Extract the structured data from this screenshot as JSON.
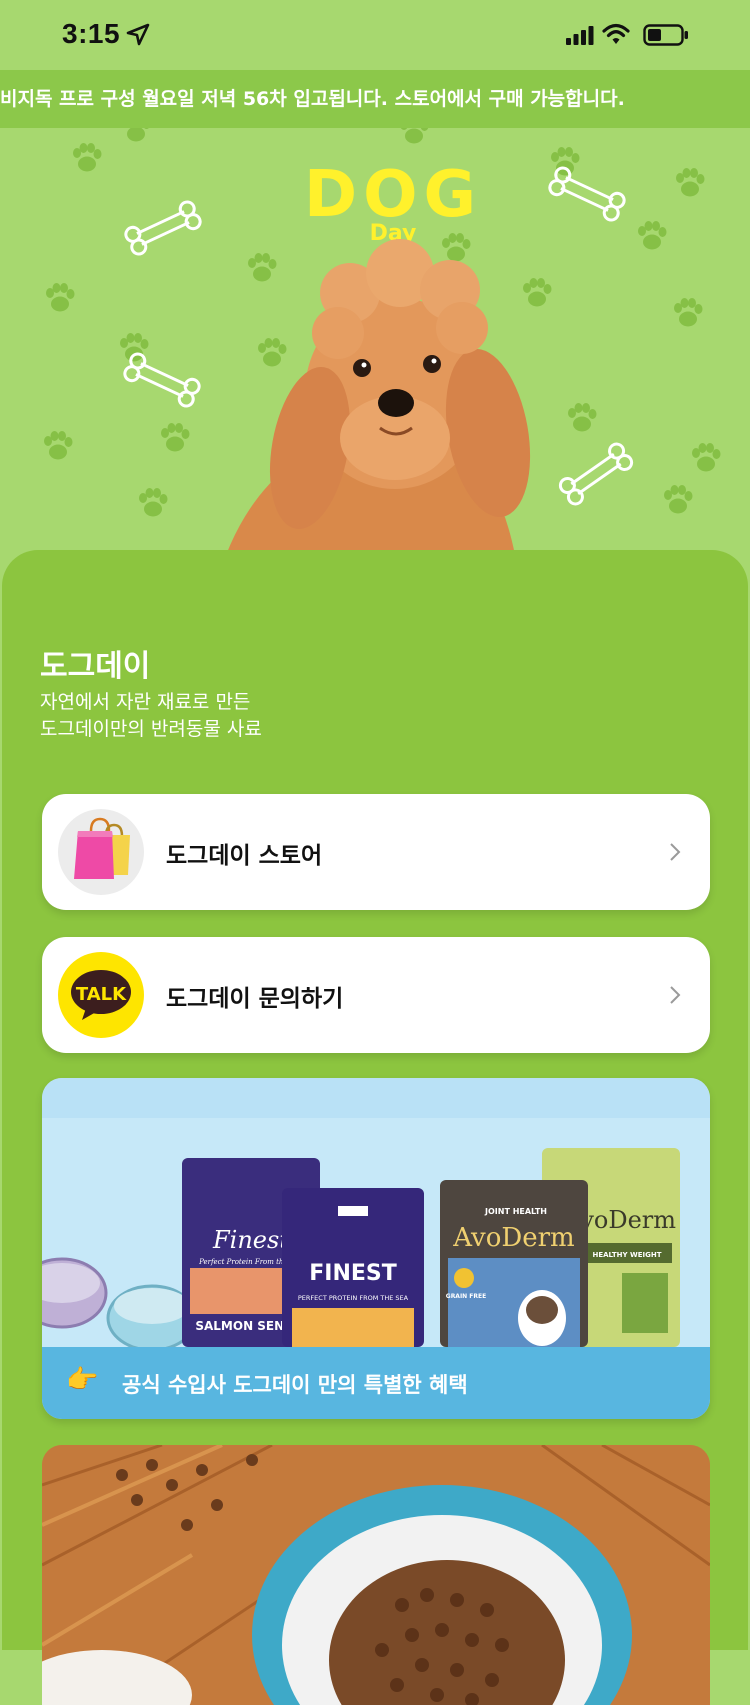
{
  "status_bar": {
    "time": "3:15",
    "icons": [
      "location-arrow-icon",
      "signal-icon",
      "wifi-icon",
      "battery-icon"
    ]
  },
  "marquee": {
    "text": "비지독 프로 구성 월요일 저녁 56차 입고됩니다. 스토어에서 구매 가능합니다."
  },
  "hero": {
    "logo_main": "DOG",
    "logo_sub": "Day"
  },
  "brand": {
    "title": "도그데이",
    "desc_line1": "자연에서 자란 재료로 만든",
    "desc_line2": "도그데이만의 반려동물 사료"
  },
  "menu": [
    {
      "label": "도그데이 스토어",
      "icon": "shopping-bag-icon"
    },
    {
      "label": "도그데이 문의하기",
      "icon": "kakao-talk-icon",
      "icon_text": "TALK"
    }
  ],
  "banner": {
    "text": "공식 수입사 도그데이 만의 특별한 혜택",
    "hand": "👉",
    "products": [
      {
        "brand": "Finest",
        "sub": "Perfect Protein From the Sea",
        "label": "SALMON SENI"
      },
      {
        "brand": "FINEST",
        "sub": "PERFECT PROTEIN FROM THE SEA"
      },
      {
        "brand": "AvoDerm",
        "sub": "JOINT HEALTH",
        "badge": "GRAIN FREE"
      },
      {
        "brand": "AvoDerm",
        "sub": "HEALTHY WEIGHT"
      }
    ]
  },
  "colors": {
    "background": "#a7d86f",
    "panel": "#8cc53f",
    "marquee": "#8cc84a",
    "banner_strip": "#58b6e0",
    "logo": "#fff12c",
    "kakao": "#fee500"
  }
}
